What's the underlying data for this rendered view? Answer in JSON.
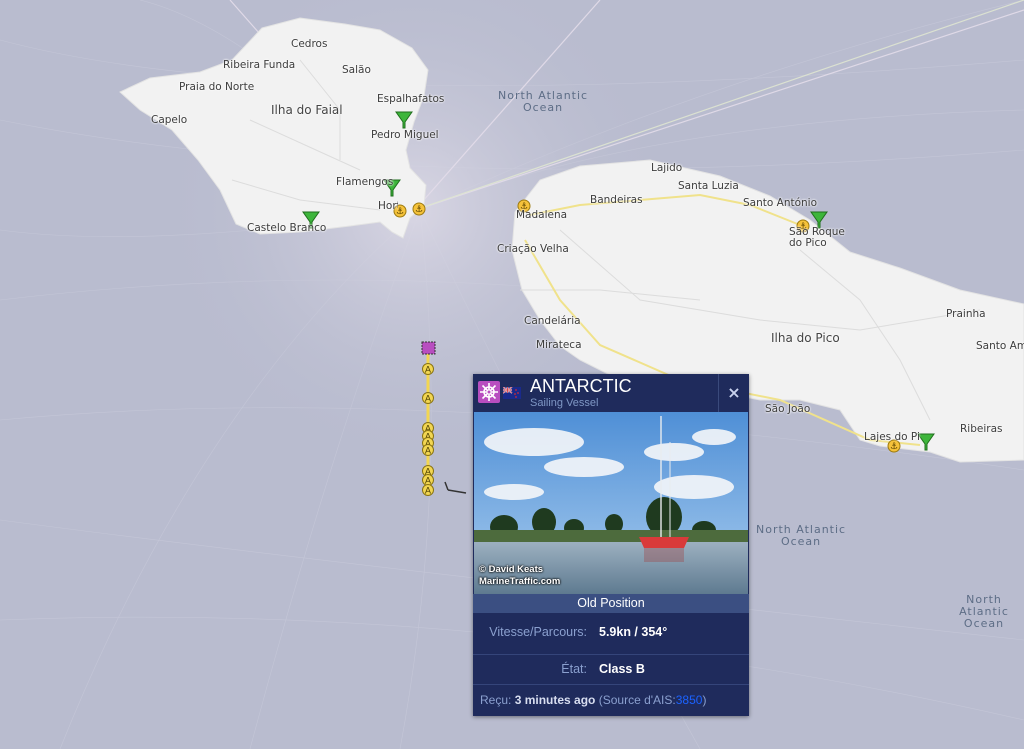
{
  "places": [
    {
      "id": "cedros",
      "name": "Cedros"
    },
    {
      "id": "ribeira-funda",
      "name": "Ribeira Funda"
    },
    {
      "id": "salao",
      "name": "Salão"
    },
    {
      "id": "praia-do-norte",
      "name": "Praia do Norte"
    },
    {
      "id": "espalhafatos",
      "name": "Espalhafatos"
    },
    {
      "id": "ilha-do-faial",
      "name": "Ilha do Faial"
    },
    {
      "id": "capelo",
      "name": "Capelo"
    },
    {
      "id": "pedro-miguel",
      "name": "Pedro Miguel"
    },
    {
      "id": "flamengos",
      "name": "Flamengos"
    },
    {
      "id": "horta",
      "name": "Horta"
    },
    {
      "id": "castelo-branco",
      "name": "Castelo Branco"
    },
    {
      "id": "lajido",
      "name": "Lajido"
    },
    {
      "id": "santa-luzia",
      "name": "Santa Luzia"
    },
    {
      "id": "bandeiras",
      "name": "Bandeiras"
    },
    {
      "id": "santo-antonio",
      "name": "Santo António"
    },
    {
      "id": "madalena",
      "name": "Madalena"
    },
    {
      "id": "sao-roque",
      "name": "São Roque do Pico"
    },
    {
      "id": "criacao-velha",
      "name": "Criação Velha"
    },
    {
      "id": "candelaria",
      "name": "Candelária"
    },
    {
      "id": "ilha-do-pico",
      "name": "Ilha do Pico"
    },
    {
      "id": "prainha",
      "name": "Prainha"
    },
    {
      "id": "santo-amaro",
      "name": "Santo Am"
    },
    {
      "id": "mirateca",
      "name": "Mirateca"
    },
    {
      "id": "sao-joao",
      "name": "São João"
    },
    {
      "id": "lajes-do-pico",
      "name": "Lajes do Pi"
    },
    {
      "id": "ribeiras",
      "name": "Ribeiras"
    }
  ],
  "oceans": [
    "North Atlantic\nOcean",
    "North Atlantic\nOcean",
    "North Atlantic\nOcean"
  ],
  "track_marker_letter": "A",
  "popup": {
    "vessel_name": "ANTARCTIC",
    "vessel_type": "Sailing Vessel",
    "close_label": "×",
    "photo_credit_1": "© David Keats",
    "photo_credit_2": "MarineTraffic.com",
    "position_status": "Old Position",
    "speed_label": "Vitesse/Parcours:",
    "speed_value": "5.9kn / 354°",
    "state_label": "État:",
    "state_value": "Class B",
    "received_label": "Reçu:",
    "received_value": "3 minutes ago",
    "source_prefix": "(Source d'AIS:",
    "source_number": "3850",
    "source_suffix": ")"
  },
  "colors": {
    "sea": "#b9bccf",
    "land": "#f2f2f2",
    "popup_bg": "#1f2b5c",
    "vessel_purple": "#b84ec0",
    "track": "#f2d652",
    "port": "#f5c23a",
    "station": "#3db53b"
  }
}
